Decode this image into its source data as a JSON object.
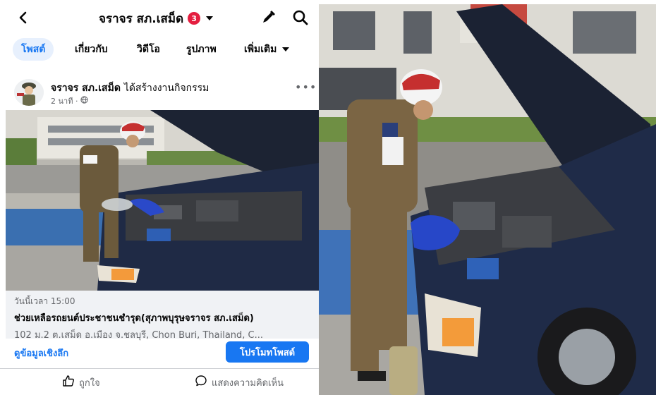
{
  "header": {
    "page_name": "จราจร สภ.เสม็ด",
    "notification_count": "3"
  },
  "tabs": [
    {
      "label": "โพสต์",
      "active": true
    },
    {
      "label": "เกี่ยวกับ",
      "active": false
    },
    {
      "label": "วิดีโอ",
      "active": false
    },
    {
      "label": "รูปภาพ",
      "active": false
    },
    {
      "label": "เพิ่มเติม",
      "active": false
    }
  ],
  "post": {
    "author": "จราจร สภ.เสม็ด",
    "action": "ได้สร้างงานกิจกรรม",
    "time": "2 นาที ·",
    "more": "•••"
  },
  "event": {
    "datetime": "วันนี้เวลา 15:00",
    "title": "ช่วยเหลือรถยนต์ประชาชนชำรุด(สุภาพบุรุษจราจร สภ.เสม็ด)",
    "location": "102 ม.2 ต.เสม็ด อ.เมือง จ.ชลบุรี, Chon Buri, Thailand, C..."
  },
  "actions": {
    "insights": "ดูข้อมูลเชิงลึก",
    "promote": "โปรโมทโพสต์",
    "like": "ถูกใจ",
    "comment": "แสดงความคิดเห็น"
  },
  "colors": {
    "brand_blue": "#1877f2",
    "badge_red": "#e41e3f",
    "secondary_text": "#65676b"
  },
  "icons": {
    "back": "chevron-left-icon",
    "edit": "pencil-icon",
    "search": "search-icon",
    "globe": "globe-icon",
    "like": "thumbs-up-icon",
    "comment": "comment-icon"
  }
}
